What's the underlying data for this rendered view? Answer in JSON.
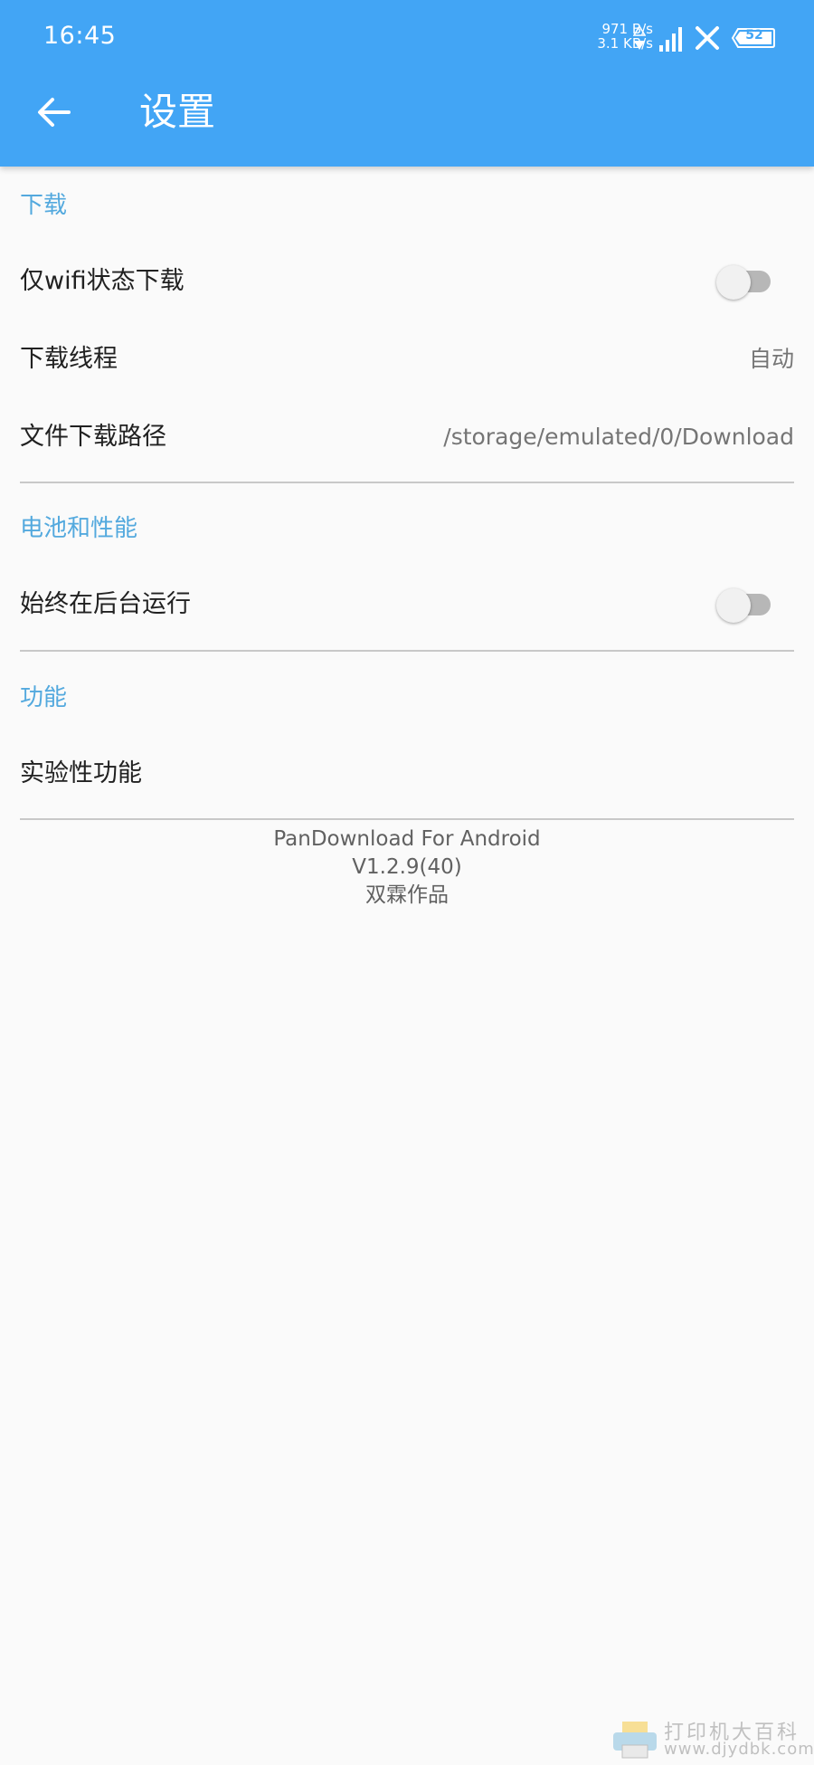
{
  "status_bar": {
    "time": "16:45",
    "upload_speed": "971 B/s",
    "download_speed": "3.1 KB/s",
    "battery": "52",
    "icons": [
      "net-speed-arrows-icon",
      "signal-icon",
      "wifi-off-icon",
      "battery-icon"
    ]
  },
  "app_bar": {
    "back_icon": "arrow-left-icon",
    "title": "设置",
    "color": "#42a5f5"
  },
  "sections": {
    "download": {
      "header": "下载",
      "wifi_only": {
        "label": "仅wifi状态下载",
        "enabled": false
      },
      "threads": {
        "label": "下载线程",
        "value": "自动"
      },
      "path": {
        "label": "文件下载路径",
        "value": "/storage/emulated/0/Download"
      }
    },
    "battery": {
      "header": "电池和性能",
      "run_background": {
        "label": "始终在后台运行",
        "enabled": false
      }
    },
    "features": {
      "header": "功能",
      "experimental": {
        "label": "实验性功能"
      }
    }
  },
  "footer": {
    "app_name": "PanDownload For Android",
    "version": "V1.2.9(40)",
    "author": "双霖作品"
  },
  "watermark": {
    "line1": "打印机大百科",
    "line2": "www.djydbk.com"
  },
  "colors": {
    "accent": "#53a9de",
    "background": "#fafafa"
  }
}
